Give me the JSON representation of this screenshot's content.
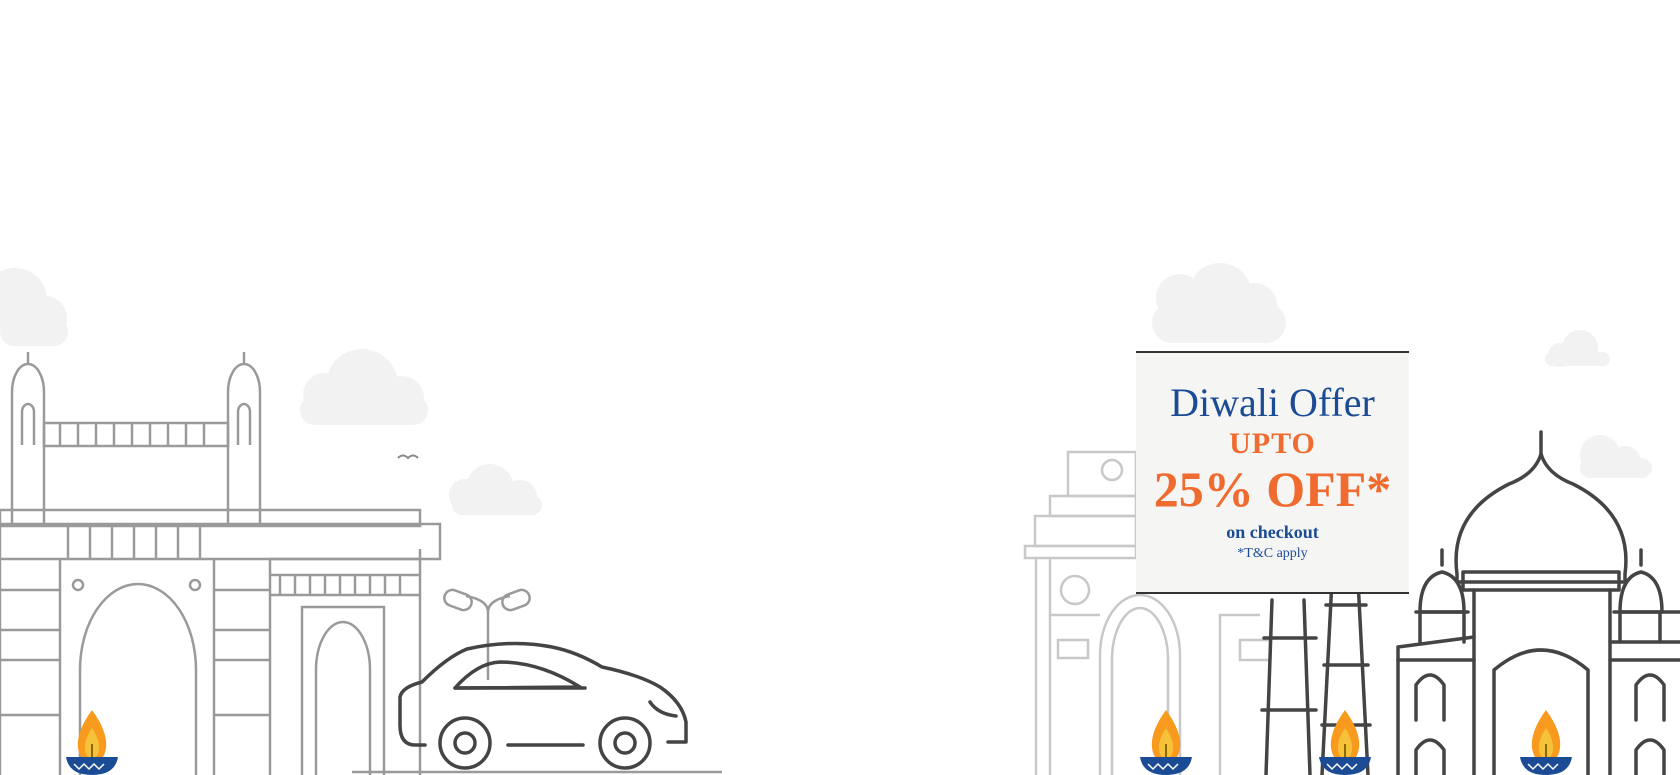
{
  "offer": {
    "title": "Diwali Offer",
    "upto": "UPTO",
    "discount": "25% OFF*",
    "checkout": "on checkout",
    "terms": "*T&C apply"
  },
  "colors": {
    "title_blue": "#1c4b96",
    "accent_orange": "#ef6b2f",
    "card_bg": "#f5f5f4",
    "line_gray": "#9a9a9a",
    "line_dark": "#444444",
    "cloud_gray": "#f2f2f2"
  },
  "icons": [
    "cloud-icon",
    "bird-icon",
    "diya-lamp-icon",
    "car-icon",
    "street-lamp-icon"
  ]
}
